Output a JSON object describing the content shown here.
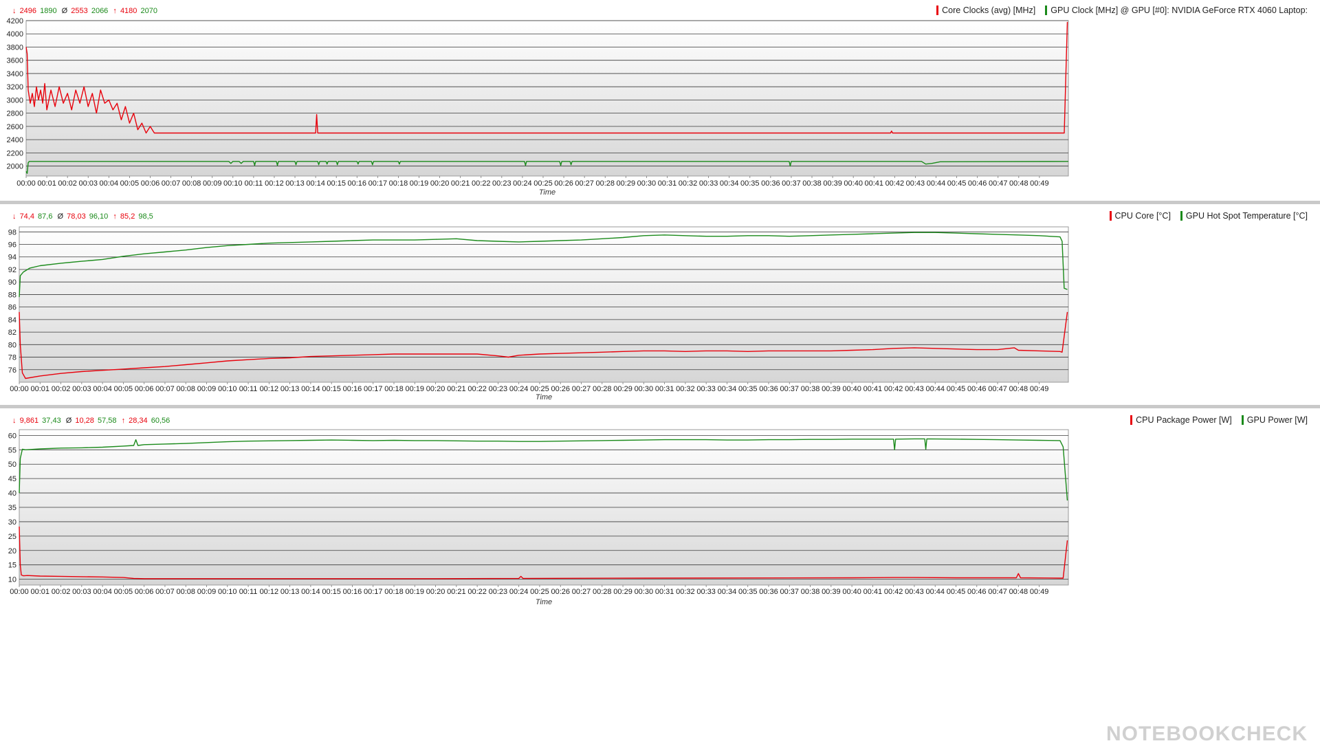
{
  "colors": {
    "red": "#e8000b",
    "green": "#1a8a1a"
  },
  "panels": [
    {
      "stats": {
        "min": {
          "arrow": "↓",
          "a": "2496",
          "b": "1890"
        },
        "avg": {
          "arrow": "Ø",
          "a": "2553",
          "b": "2066"
        },
        "max": {
          "arrow": "↑",
          "a": "4180",
          "b": "2070"
        }
      },
      "legend": [
        "Core Clocks (avg) [MHz]",
        "GPU Clock [MHz] @ GPU [#0]: NVIDIA GeForce RTX 4060 Laptop:"
      ]
    },
    {
      "stats": {
        "min": {
          "arrow": "↓",
          "a": "74,4",
          "b": "87,6"
        },
        "avg": {
          "arrow": "Ø",
          "a": "78,03",
          "b": "96,10"
        },
        "max": {
          "arrow": "↑",
          "a": "85,2",
          "b": "98,5"
        }
      },
      "legend": [
        "CPU Core [°C]",
        "GPU Hot Spot Temperature [°C]"
      ]
    },
    {
      "stats": {
        "min": {
          "arrow": "↓",
          "a": "9,861",
          "b": "37,43"
        },
        "avg": {
          "arrow": "Ø",
          "a": "10,28",
          "b": "57,58"
        },
        "max": {
          "arrow": "↑",
          "a": "28,34",
          "b": "60,56"
        }
      },
      "legend": [
        "CPU Package Power [W]",
        "GPU Power [W]"
      ]
    }
  ],
  "watermark": "NOTEBOOKCHECK",
  "chart_data": [
    {
      "type": "line",
      "xlabel": "Time",
      "x_ticks": [
        "00:00",
        "00:01",
        "00:02",
        "00:03",
        "00:04",
        "00:05",
        "00:06",
        "00:07",
        "00:08",
        "00:09",
        "00:10",
        "00:11",
        "00:12",
        "00:13",
        "00:14",
        "00:15",
        "00:16",
        "00:17",
        "00:18",
        "00:19",
        "00:20",
        "00:21",
        "00:22",
        "00:23",
        "00:24",
        "00:25",
        "00:26",
        "00:27",
        "00:28",
        "00:29",
        "00:30",
        "00:31",
        "00:32",
        "00:33",
        "00:34",
        "00:35",
        "00:36",
        "00:37",
        "00:38",
        "00:39",
        "00:40",
        "00:41",
        "00:42",
        "00:43",
        "00:44",
        "00:45",
        "00:46",
        "00:47",
        "00:48",
        "00:49"
      ],
      "xlim": [
        0,
        50.4
      ],
      "ylim": [
        1850,
        4200
      ],
      "y_ticks": [
        2000,
        2200,
        2400,
        2600,
        2800,
        3000,
        3200,
        3400,
        3600,
        3800,
        4000,
        4200
      ],
      "grid": true,
      "legend_position": "top-right",
      "series": [
        {
          "name": "Core Clocks (avg) [MHz]",
          "color": "#e8000b",
          "x": [
            0,
            0.05,
            0.1,
            0.2,
            0.3,
            0.4,
            0.5,
            0.6,
            0.7,
            0.8,
            0.9,
            1.0,
            1.2,
            1.4,
            1.6,
            1.8,
            2.0,
            2.2,
            2.4,
            2.6,
            2.8,
            3.0,
            3.2,
            3.4,
            3.6,
            3.8,
            4.0,
            4.2,
            4.4,
            4.6,
            4.8,
            5.0,
            5.2,
            5.4,
            5.6,
            5.8,
            6.0,
            6.1,
            6.2,
            7,
            10,
            14.0,
            14.05,
            14.1,
            14.15,
            14.2,
            20,
            30,
            41.8,
            41.85,
            41.9,
            42,
            50.0,
            50.2,
            50.35
          ],
          "y": [
            3800,
            3700,
            3150,
            2950,
            3100,
            2900,
            3200,
            3000,
            3150,
            2950,
            3250,
            2850,
            3150,
            2900,
            3200,
            2950,
            3100,
            2850,
            3150,
            2950,
            3200,
            2900,
            3100,
            2800,
            3150,
            2950,
            3000,
            2850,
            2950,
            2700,
            2900,
            2650,
            2800,
            2550,
            2650,
            2500,
            2600,
            2550,
            2500,
            2500,
            2500,
            2500,
            2780,
            2500,
            2500,
            2500,
            2500,
            2500,
            2500,
            2530,
            2500,
            2500,
            2500,
            2500,
            4180
          ]
        },
        {
          "name": "GPU Clock [MHz] @ GPU [#0]: NVIDIA GeForce RTX 4060 Laptop:",
          "color": "#1a8a1a",
          "x": [
            0,
            0.05,
            0.1,
            0.15,
            0.3,
            5,
            9.8,
            9.9,
            10.0,
            10.3,
            10.4,
            10.5,
            11.0,
            11.05,
            11.1,
            12.1,
            12.15,
            12.2,
            13.0,
            13.05,
            13.1,
            14.1,
            14.15,
            14.2,
            14.5,
            14.55,
            14.6,
            15.0,
            15.05,
            15.1,
            16.0,
            16.05,
            16.1,
            16.7,
            16.75,
            16.8,
            18.0,
            18.05,
            18.1,
            24.1,
            24.15,
            24.2,
            25.8,
            25.85,
            25.9,
            26.3,
            26.35,
            26.4,
            36.9,
            36.95,
            37.0,
            43.3,
            43.5,
            43.8,
            44.2,
            50.4
          ],
          "y": [
            1920,
            1890,
            2050,
            2070,
            2070,
            2070,
            2070,
            2040,
            2070,
            2070,
            2040,
            2070,
            2070,
            2010,
            2070,
            2070,
            2010,
            2070,
            2070,
            2020,
            2070,
            2070,
            2020,
            2070,
            2070,
            2030,
            2070,
            2070,
            2020,
            2070,
            2070,
            2030,
            2070,
            2070,
            2020,
            2070,
            2070,
            2030,
            2070,
            2070,
            2010,
            2070,
            2070,
            2010,
            2070,
            2070,
            2020,
            2070,
            2070,
            2000,
            2070,
            2070,
            2030,
            2040,
            2065,
            2070
          ]
        }
      ]
    },
    {
      "type": "line",
      "xlabel": "Time",
      "x_ticks": [
        "00:00",
        "00:01",
        "00:02",
        "00:03",
        "00:04",
        "00:05",
        "00:06",
        "00:07",
        "00:08",
        "00:09",
        "00:10",
        "00:11",
        "00:12",
        "00:13",
        "00:14",
        "00:15",
        "00:16",
        "00:17",
        "00:18",
        "00:19",
        "00:20",
        "00:21",
        "00:22",
        "00:23",
        "00:24",
        "00:25",
        "00:26",
        "00:27",
        "00:28",
        "00:29",
        "00:30",
        "00:31",
        "00:32",
        "00:33",
        "00:34",
        "00:35",
        "00:36",
        "00:37",
        "00:38",
        "00:39",
        "00:40",
        "00:41",
        "00:42",
        "00:43",
        "00:44",
        "00:45",
        "00:46",
        "00:47",
        "00:48",
        "00:49"
      ],
      "xlim": [
        0,
        50.4
      ],
      "ylim": [
        74,
        98.8
      ],
      "y_ticks": [
        76,
        78,
        80,
        82,
        84,
        86,
        88,
        90,
        92,
        94,
        96,
        98
      ],
      "grid": true,
      "legend_position": "top-right",
      "series": [
        {
          "name": "CPU Core [°C]",
          "color": "#e8000b",
          "x": [
            0,
            0.05,
            0.15,
            0.3,
            1,
            2,
            3,
            4,
            5,
            6,
            7,
            8,
            9,
            10,
            11,
            12,
            13,
            14,
            15,
            16,
            17,
            18,
            19,
            20,
            21,
            22,
            23,
            23.5,
            24,
            25,
            26,
            27,
            28,
            29,
            30,
            31,
            32,
            33,
            34,
            35,
            36,
            37,
            38,
            39,
            40,
            41,
            42,
            43,
            44,
            45,
            46,
            47,
            47.8,
            48,
            49,
            50,
            50.1,
            50.35
          ],
          "y": [
            85.2,
            80,
            75.5,
            74.6,
            75.0,
            75.4,
            75.7,
            75.9,
            76.1,
            76.3,
            76.5,
            76.8,
            77.1,
            77.4,
            77.6,
            77.8,
            77.9,
            78.1,
            78.2,
            78.3,
            78.4,
            78.5,
            78.5,
            78.5,
            78.5,
            78.5,
            78.2,
            78.0,
            78.3,
            78.5,
            78.6,
            78.7,
            78.8,
            78.9,
            79.0,
            79.0,
            78.9,
            79.0,
            79.0,
            78.9,
            79.0,
            79.0,
            79.0,
            79.0,
            79.1,
            79.2,
            79.4,
            79.5,
            79.4,
            79.3,
            79.2,
            79.2,
            79.5,
            79.1,
            79.0,
            78.9,
            78.8,
            85.2
          ]
        },
        {
          "name": "GPU Hot Spot Temperature [°C]",
          "color": "#1a8a1a",
          "x": [
            0,
            0.05,
            0.2,
            0.5,
            1,
            2,
            3,
            4,
            5,
            6,
            7,
            8,
            9,
            10,
            11,
            12,
            13,
            14,
            15,
            16,
            17,
            18,
            19,
            20,
            21,
            22,
            23,
            24,
            25,
            26,
            27,
            28,
            29,
            30,
            31,
            32,
            33,
            34,
            35,
            36,
            37,
            38,
            39,
            40,
            41,
            42,
            43,
            44,
            45,
            46,
            47,
            48,
            49,
            50,
            50.1,
            50.2,
            50.35
          ],
          "y": [
            87.6,
            91,
            91.6,
            92.2,
            92.6,
            93.0,
            93.3,
            93.6,
            94.1,
            94.5,
            94.8,
            95.1,
            95.5,
            95.8,
            96.0,
            96.2,
            96.3,
            96.4,
            96.5,
            96.6,
            96.7,
            96.7,
            96.7,
            96.8,
            96.9,
            96.6,
            96.5,
            96.4,
            96.5,
            96.6,
            96.7,
            96.9,
            97.1,
            97.4,
            97.5,
            97.4,
            97.3,
            97.3,
            97.4,
            97.4,
            97.3,
            97.4,
            97.5,
            97.6,
            97.7,
            97.8,
            97.9,
            97.9,
            97.8,
            97.7,
            97.6,
            97.5,
            97.4,
            97.2,
            96.5,
            89,
            88.8
          ]
        }
      ]
    },
    {
      "type": "line",
      "xlabel": "Time",
      "x_ticks": [
        "00:00",
        "00:01",
        "00:02",
        "00:03",
        "00:04",
        "00:05",
        "00:06",
        "00:07",
        "00:08",
        "00:09",
        "00:10",
        "00:11",
        "00:12",
        "00:13",
        "00:14",
        "00:15",
        "00:16",
        "00:17",
        "00:18",
        "00:19",
        "00:20",
        "00:21",
        "00:22",
        "00:23",
        "00:24",
        "00:25",
        "00:26",
        "00:27",
        "00:28",
        "00:29",
        "00:30",
        "00:31",
        "00:32",
        "00:33",
        "00:34",
        "00:35",
        "00:36",
        "00:37",
        "00:38",
        "00:39",
        "00:40",
        "00:41",
        "00:42",
        "00:43",
        "00:44",
        "00:45",
        "00:46",
        "00:47",
        "00:48",
        "00:49"
      ],
      "xlim": [
        0,
        50.4
      ],
      "ylim": [
        8,
        62
      ],
      "y_ticks": [
        10,
        15,
        20,
        25,
        30,
        35,
        40,
        45,
        50,
        55,
        60
      ],
      "grid": true,
      "legend_position": "top-right",
      "series": [
        {
          "name": "CPU Package Power [W]",
          "color": "#e8000b",
          "x": [
            0,
            0.05,
            0.1,
            0.2,
            0.4,
            1,
            2,
            3,
            4,
            5,
            5.5,
            6,
            10,
            15,
            20,
            24,
            24.1,
            24.2,
            30,
            40,
            42,
            43,
            45,
            47,
            47.9,
            48,
            48.1,
            50,
            50.15,
            50.35
          ],
          "y": [
            28.3,
            15,
            11.5,
            11.2,
            11.3,
            11.1,
            11.0,
            10.9,
            10.8,
            10.6,
            10.3,
            10.2,
            10.2,
            10.2,
            10.2,
            10.3,
            11.0,
            10.3,
            10.4,
            10.5,
            10.6,
            10.6,
            10.5,
            10.5,
            10.5,
            12.0,
            10.5,
            10.4,
            10.4,
            23.5
          ]
        },
        {
          "name": "GPU Power [W]",
          "color": "#1a8a1a",
          "x": [
            0,
            0.05,
            0.15,
            0.3,
            1,
            2,
            3,
            4,
            5,
            5.5,
            5.6,
            5.7,
            6,
            7,
            8,
            9,
            10,
            11,
            12,
            13,
            14,
            15,
            16,
            17,
            18,
            19,
            20,
            21,
            22,
            23,
            24,
            25,
            26,
            27,
            28,
            29,
            30,
            31,
            32,
            33,
            34,
            35,
            36,
            37,
            38,
            39,
            40,
            41,
            42,
            42.05,
            42.1,
            43,
            43.5,
            43.55,
            43.6,
            45,
            46,
            47,
            48,
            49,
            50,
            50.15,
            50.35
          ],
          "y": [
            40,
            52,
            55.2,
            55.0,
            55.3,
            55.6,
            55.7,
            55.9,
            56.3,
            56.5,
            58.5,
            56.5,
            56.8,
            57.0,
            57.2,
            57.5,
            57.8,
            58.0,
            58.1,
            58.2,
            58.3,
            58.4,
            58.3,
            58.2,
            58.3,
            58.2,
            58.2,
            58.1,
            58.0,
            58.0,
            57.9,
            57.9,
            58.0,
            58.1,
            58.2,
            58.3,
            58.4,
            58.5,
            58.5,
            58.5,
            58.4,
            58.4,
            58.5,
            58.5,
            58.6,
            58.6,
            58.7,
            58.7,
            58.7,
            55.0,
            58.7,
            58.8,
            58.8,
            55.2,
            58.8,
            58.7,
            58.6,
            58.5,
            58.4,
            58.3,
            58.2,
            56,
            37.4
          ]
        }
      ]
    }
  ]
}
